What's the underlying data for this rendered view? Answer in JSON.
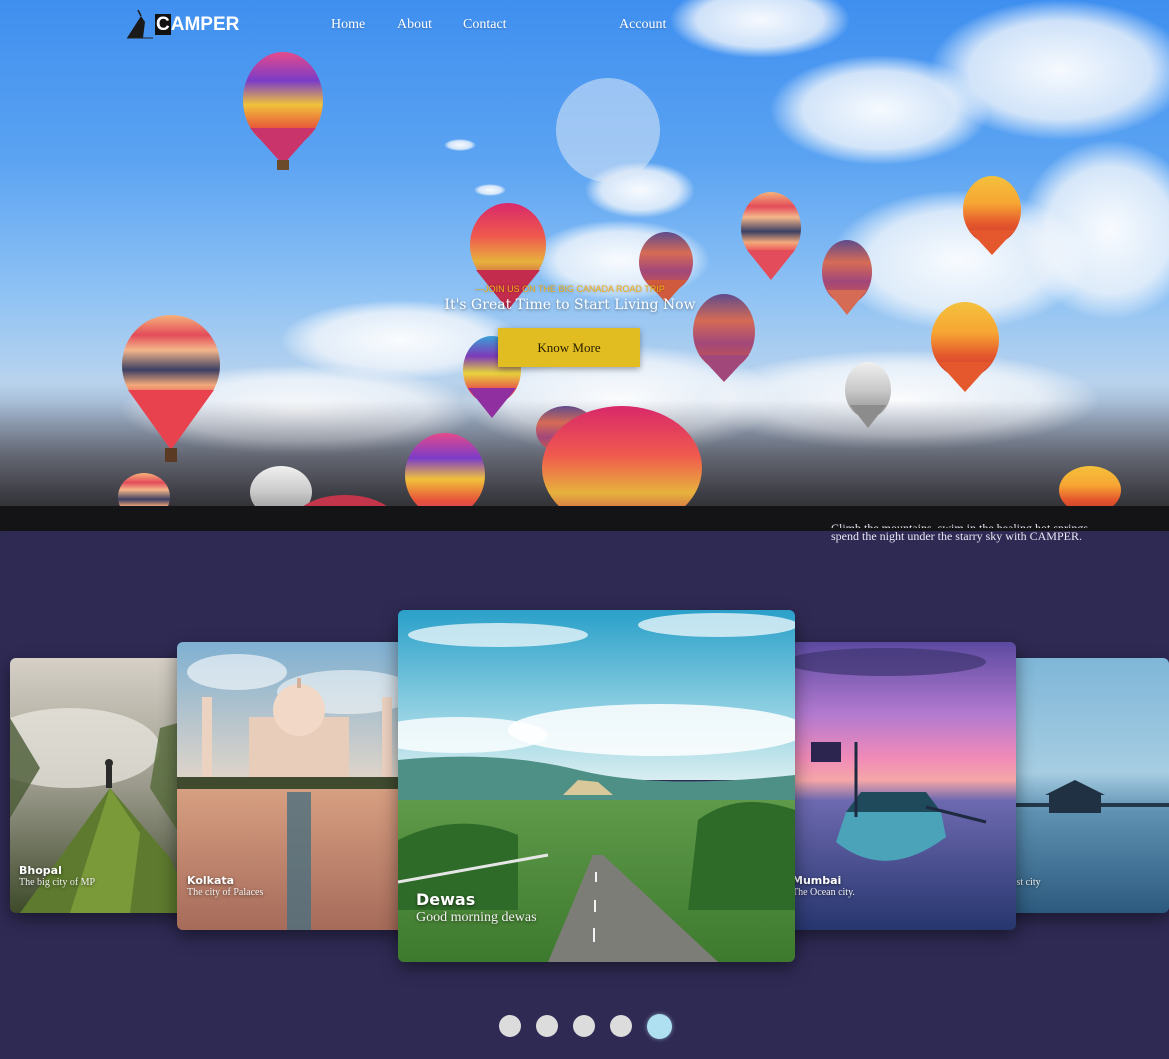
{
  "nav": {
    "brand_first": "C",
    "brand_rest": "AMPER",
    "links": [
      "Home",
      "About",
      "Contact"
    ],
    "account": "Account"
  },
  "hero": {
    "kicker": "—JOIN US ON THE BIG CANADA ROAD TRIP",
    "title": "It's Great Time to Start Living Now",
    "button": "Know More"
  },
  "section": {
    "text_cut": "Climb the mountains, swim in the healing hot springs",
    "text": "spend the night under the starry sky with CAMPER."
  },
  "slides": [
    {
      "title": "Bhopal",
      "subtitle": "The big city of MP"
    },
    {
      "title": "Kolkata",
      "subtitle": "The city of Palaces"
    },
    {
      "title": "Dewas",
      "subtitle": "Good morning dewas"
    },
    {
      "title": "Mumbai",
      "subtitle": "The Ocean city."
    },
    {
      "title": "",
      "subtitle": "nest city"
    }
  ],
  "carousel": {
    "active_index": 4,
    "count": 5
  },
  "colors": {
    "accent": "#e2bd21",
    "kicker": "#f3b21a",
    "section_bg": "#2f2a54",
    "dot": "#dcdcdc",
    "dot_active": "#aee0f1"
  }
}
